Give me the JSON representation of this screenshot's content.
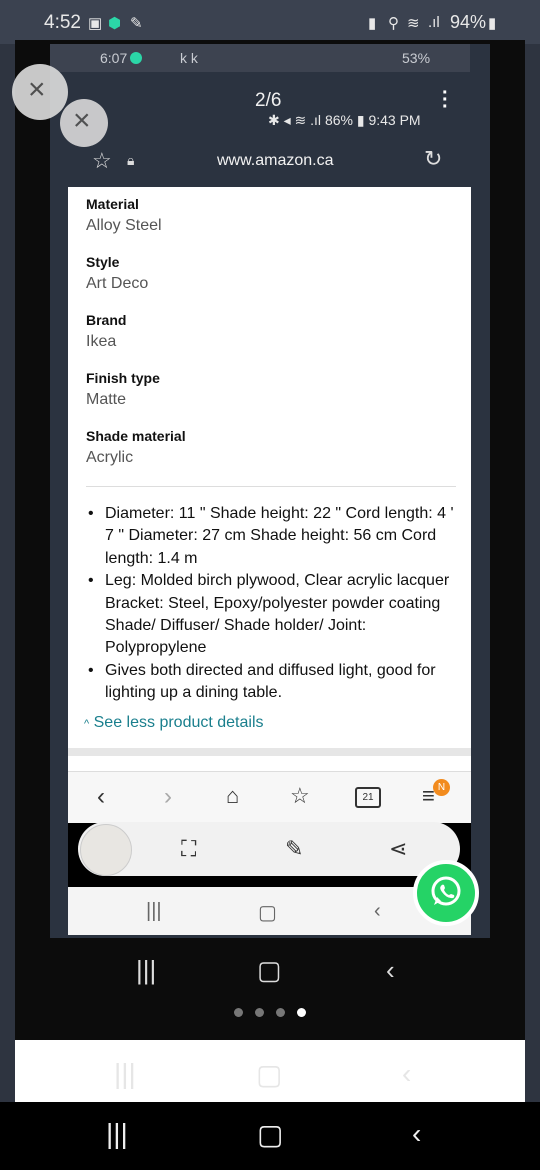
{
  "outer_status": {
    "time": "4:52",
    "battery": "94%"
  },
  "inner_status_2": {
    "time": "6:07",
    "letters": "k k",
    "battery": "53%"
  },
  "gallery": {
    "page_indicator": "2/6"
  },
  "inner_status_3": {
    "battery": "86%",
    "time": "9:43 PM"
  },
  "browser": {
    "url": "www.amazon.ca"
  },
  "specs": [
    {
      "label": "Material",
      "value": "Alloy Steel"
    },
    {
      "label": "Style",
      "value": "Art Deco"
    },
    {
      "label": "Brand",
      "value": "Ikea"
    },
    {
      "label": "Finish type",
      "value": "Matte"
    },
    {
      "label": "Shade material",
      "value": "Acrylic"
    }
  ],
  "bullets": [
    "Diameter: 11 \" Shade height: 22 \" Cord length: 4 ' 7 \" Diameter: 27 cm Shade height: 56 cm Cord length: 1.4 m",
    "Leg: Molded birch plywood, Clear acrylic lacquer Bracket: Steel, Epoxy/polyester powder coating Shade/ Diffuser/ Shade holder/ Joint: Polypropylene",
    "Gives both directed and diffused light, good for lighting up a dining table."
  ],
  "see_less_link": "See less product details",
  "browser_nav": {
    "tabs_count": "21",
    "notification_badge": "N"
  },
  "icons": {
    "close": "close-icon",
    "star": "star-icon",
    "lock": "lock-icon",
    "refresh": "refresh-icon",
    "back": "back-icon",
    "forward": "forward-icon",
    "home": "home-icon",
    "bookmarks": "bookmarks-icon",
    "tabs": "tabs-icon",
    "menu": "menu-icon",
    "scan": "scan-icon",
    "edit": "edit-icon",
    "share": "share-icon",
    "whatsapp": "whatsapp-icon"
  },
  "colors": {
    "link": "#1a7f8d",
    "whatsapp": "#25d366",
    "badge": "#f28b1e"
  }
}
